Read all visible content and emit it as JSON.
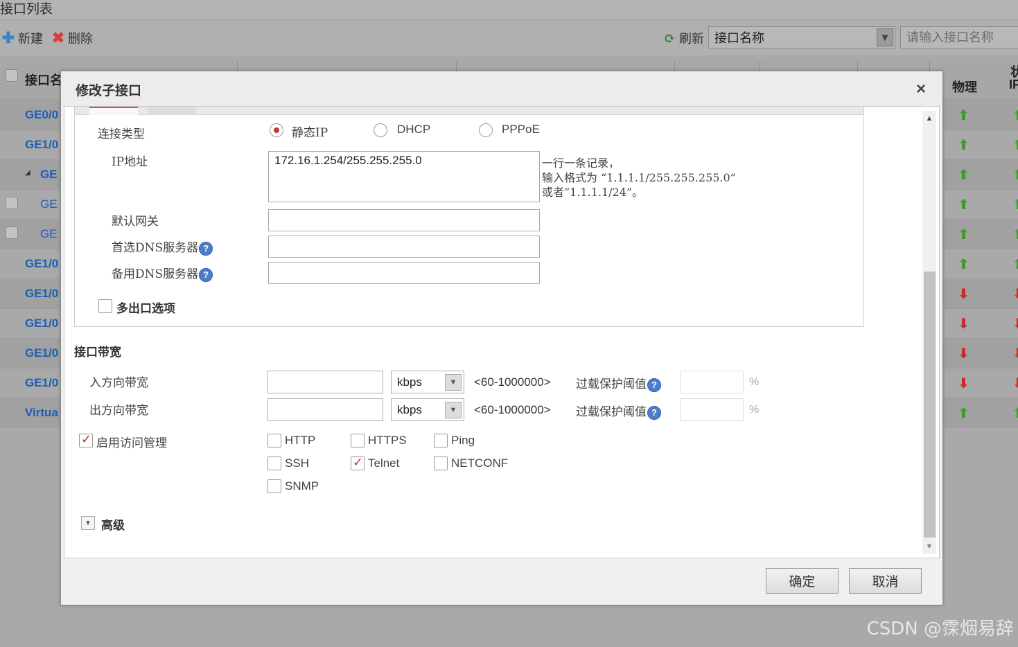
{
  "page": {
    "title": "接口列表",
    "toolbar": {
      "new": "新建",
      "delete": "删除",
      "refresh": "刷新",
      "search_type": "接口名称",
      "search_placeholder": "请输入接口名称"
    },
    "table": {
      "headers": {
        "name": "接口名",
        "physical": "物理",
        "ip": "IF",
        "status_group": "状"
      },
      "rows": [
        {
          "name": "GE0/0",
          "status": "up"
        },
        {
          "name": "GE1/0",
          "status": "up"
        },
        {
          "name": "GE",
          "status": "up"
        },
        {
          "name": "GE",
          "status": "up"
        },
        {
          "name": "GE",
          "status": "up"
        },
        {
          "name": "GE1/0",
          "status": "up"
        },
        {
          "name": "GE1/0",
          "status": "down"
        },
        {
          "name": "GE1/0",
          "status": "down"
        },
        {
          "name": "GE1/0",
          "status": "down"
        },
        {
          "name": "GE1/0",
          "status": "down"
        },
        {
          "name": "Virtua",
          "status": "up"
        }
      ]
    }
  },
  "dialog": {
    "title": "修改子接口",
    "close": "×",
    "connection": {
      "label": "连接类型",
      "options": [
        "静态IP",
        "DHCP",
        "PPPoE"
      ],
      "selected": "静态IP"
    },
    "ip": {
      "label": "IP地址",
      "value": "172.16.1.254/255.255.255.0",
      "hint1": "一行一条记录，",
      "hint2": "输入格式为 “1.1.1.1/255.255.255.0”",
      "hint3": "或者“1.1.1.1/24”。"
    },
    "gateway_label": "默认网关",
    "dns1_label": "首选DNS服务器",
    "dns2_label": "备用DNS服务器",
    "multi_exit_label": "多出口选项",
    "bandwidth": {
      "section": "接口带宽",
      "inbound_label": "入方向带宽",
      "outbound_label": "出方向带宽",
      "unit": "kbps",
      "range": "<60-1000000>",
      "overload_label": "过载保护阈值",
      "pct": "%"
    },
    "access": {
      "label": "启用访问管理",
      "enabled": true,
      "services": [
        {
          "name": "HTTP",
          "checked": false
        },
        {
          "name": "HTTPS",
          "checked": false
        },
        {
          "name": "Ping",
          "checked": false
        },
        {
          "name": "SSH",
          "checked": false
        },
        {
          "name": "Telnet",
          "checked": true
        },
        {
          "name": "NETCONF",
          "checked": false
        },
        {
          "name": "SNMP",
          "checked": false
        }
      ]
    },
    "advanced_label": "高级",
    "ok": "确定",
    "cancel": "取消"
  },
  "watermark": "CSDN @霂烟易辞"
}
